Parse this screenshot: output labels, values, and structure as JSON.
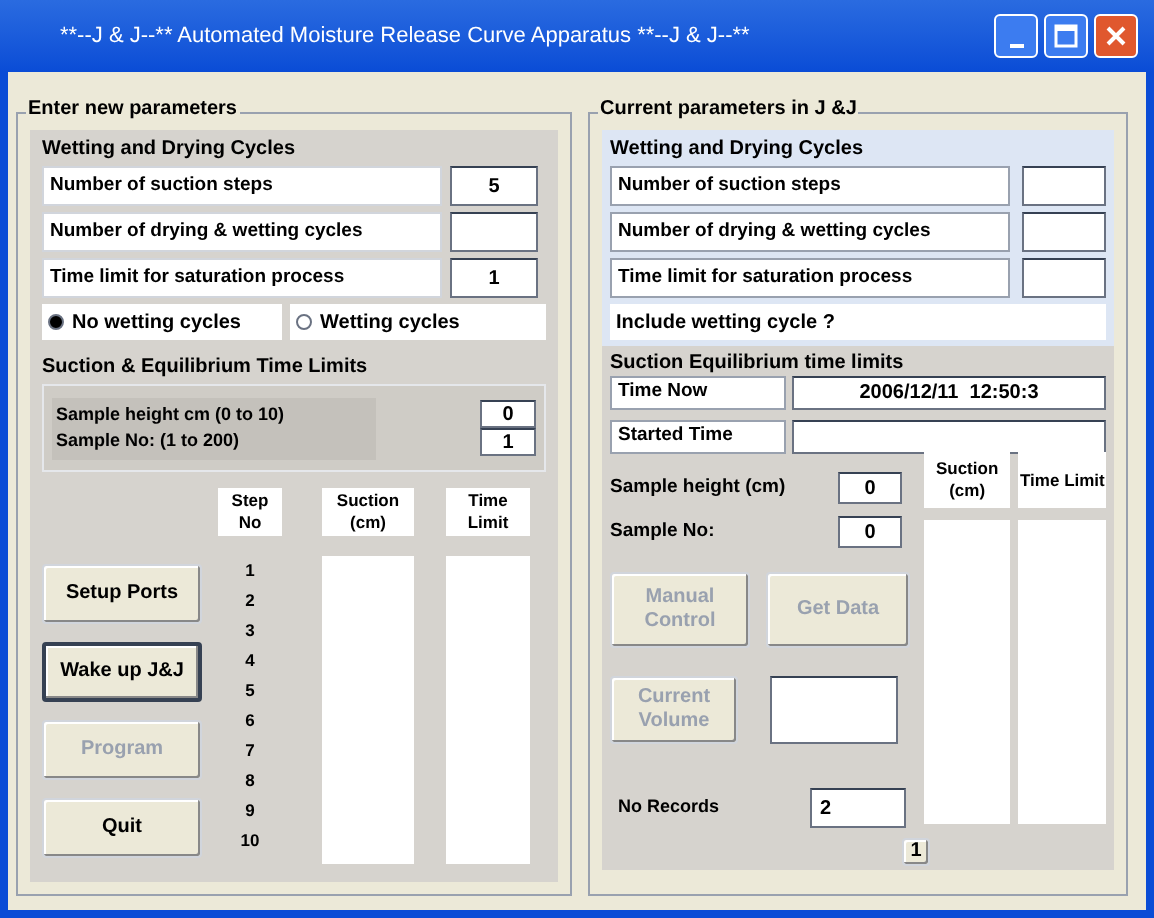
{
  "window": {
    "title": "**--J & J--**  Automated Moisture Release Curve Apparatus **--J & J--**"
  },
  "new_parameters": {
    "legend": "Enter new parameters",
    "cycles": {
      "title": "Wetting and Drying Cycles",
      "fields": [
        {
          "label": "Number of suction steps",
          "value": "5"
        },
        {
          "label": "Number of drying & wetting cycles"
        },
        {
          "label": "Time limit for saturation process",
          "value": "1"
        }
      ],
      "radios": [
        {
          "label": "No wetting cycles",
          "selected": true
        },
        {
          "label": "Wetting cycles",
          "selected": false
        }
      ]
    },
    "limits": {
      "title": "Suction & Equilibrium Time Limits",
      "sample_labels": [
        "Sample height  cm (0 to 10)",
        "Sample No:  (1 to 200)"
      ],
      "sample_values": [
        "0",
        "1"
      ],
      "columns": [
        "Step No",
        "Suction (cm)",
        "Time Limit"
      ],
      "step_numbers": [
        "1",
        "2",
        "3",
        "4",
        "5",
        "6",
        "7",
        "8",
        "9",
        "10"
      ]
    },
    "buttons": [
      {
        "label": "Setup Ports",
        "disabled": false,
        "focused": false
      },
      {
        "label": "Wake up J&J",
        "disabled": false,
        "focused": true
      },
      {
        "label": "Program",
        "disabled": true,
        "focused": false
      },
      {
        "label": "Quit",
        "disabled": false,
        "focused": false
      }
    ]
  },
  "current_parameters": {
    "legend": "Current parameters in J &J",
    "cycles": {
      "title": "Wetting and Drying Cycles",
      "fields": [
        {
          "label": "Number of  suction steps"
        },
        {
          "label": "Number of  drying & wetting cycles"
        },
        {
          "label": "Time limit for saturation process"
        }
      ],
      "include_label": "Include wetting cycle ?"
    },
    "limits": {
      "title": "Suction  Equilibrium time limits",
      "time_rows": [
        {
          "label": "Time Now",
          "value": "2006/12/11  12:50:3"
        },
        {
          "label": "Started Time"
        }
      ],
      "samples": [
        {
          "label": "Sample height (cm)",
          "value": "0"
        },
        {
          "label": "Sample No:",
          "value": "0"
        }
      ],
      "columns": [
        "Suction (cm)",
        "Time Limit"
      ],
      "buttons": [
        {
          "label": "Manual Control",
          "disabled": true
        },
        {
          "label": "Get Data",
          "disabled": true
        },
        {
          "label": "Current Volume",
          "disabled": true
        }
      ],
      "records_label": "No Records",
      "records_value": "2",
      "spin_label": "1"
    }
  }
}
